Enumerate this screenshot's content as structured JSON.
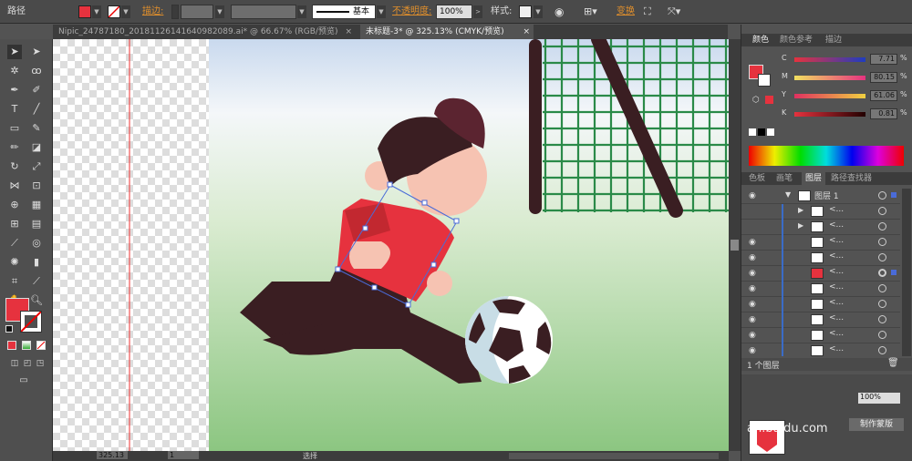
{
  "control_bar": {
    "selection_label": "路径",
    "stroke_label": "描边:",
    "stroke_style": "基本",
    "opacity_label": "不透明度:",
    "opacity_value": "100%",
    "style_label": "样式:",
    "transform_label": "变换"
  },
  "tabs": [
    {
      "label": "Nipic_24787180_20181126141640982089.ai* @ 66.67% (RGB/预览)",
      "active": false
    },
    {
      "label": "未标题-3* @ 325.13% (CMYK/预览)",
      "active": true
    }
  ],
  "color_panel": {
    "tabs": [
      "颜色",
      "颜色参考",
      "描边"
    ],
    "channels": [
      {
        "name": "C",
        "value": "7.71",
        "unit": "%"
      },
      {
        "name": "M",
        "value": "80.15",
        "unit": "%"
      },
      {
        "name": "Y",
        "value": "61.06",
        "unit": "%"
      },
      {
        "name": "K",
        "value": "0.81",
        "unit": "%"
      }
    ]
  },
  "layers_panel": {
    "tabs": [
      "色板",
      "画笔",
      "图层",
      "路径查找器"
    ],
    "layer_name": "图层 1",
    "sublayer_names": [
      "<...",
      "<...",
      "<...",
      "<...",
      "<...",
      "<...",
      "<...",
      "<...",
      "<...",
      "<...",
      "<...",
      "<..."
    ],
    "footer": "1 个图层"
  },
  "status_bar": {
    "zoom": "325.13",
    "page": "1",
    "tool": "选择"
  },
  "watermark": "an.baidu.com",
  "bottom_button": "制作蒙版",
  "colors": {
    "fill": "#e6323e",
    "dark": "#3a1e22",
    "skin": "#f6c3b2",
    "hair": "#5b2430",
    "net": "#2a8a48",
    "ball_shadow": "#c8dde6"
  }
}
